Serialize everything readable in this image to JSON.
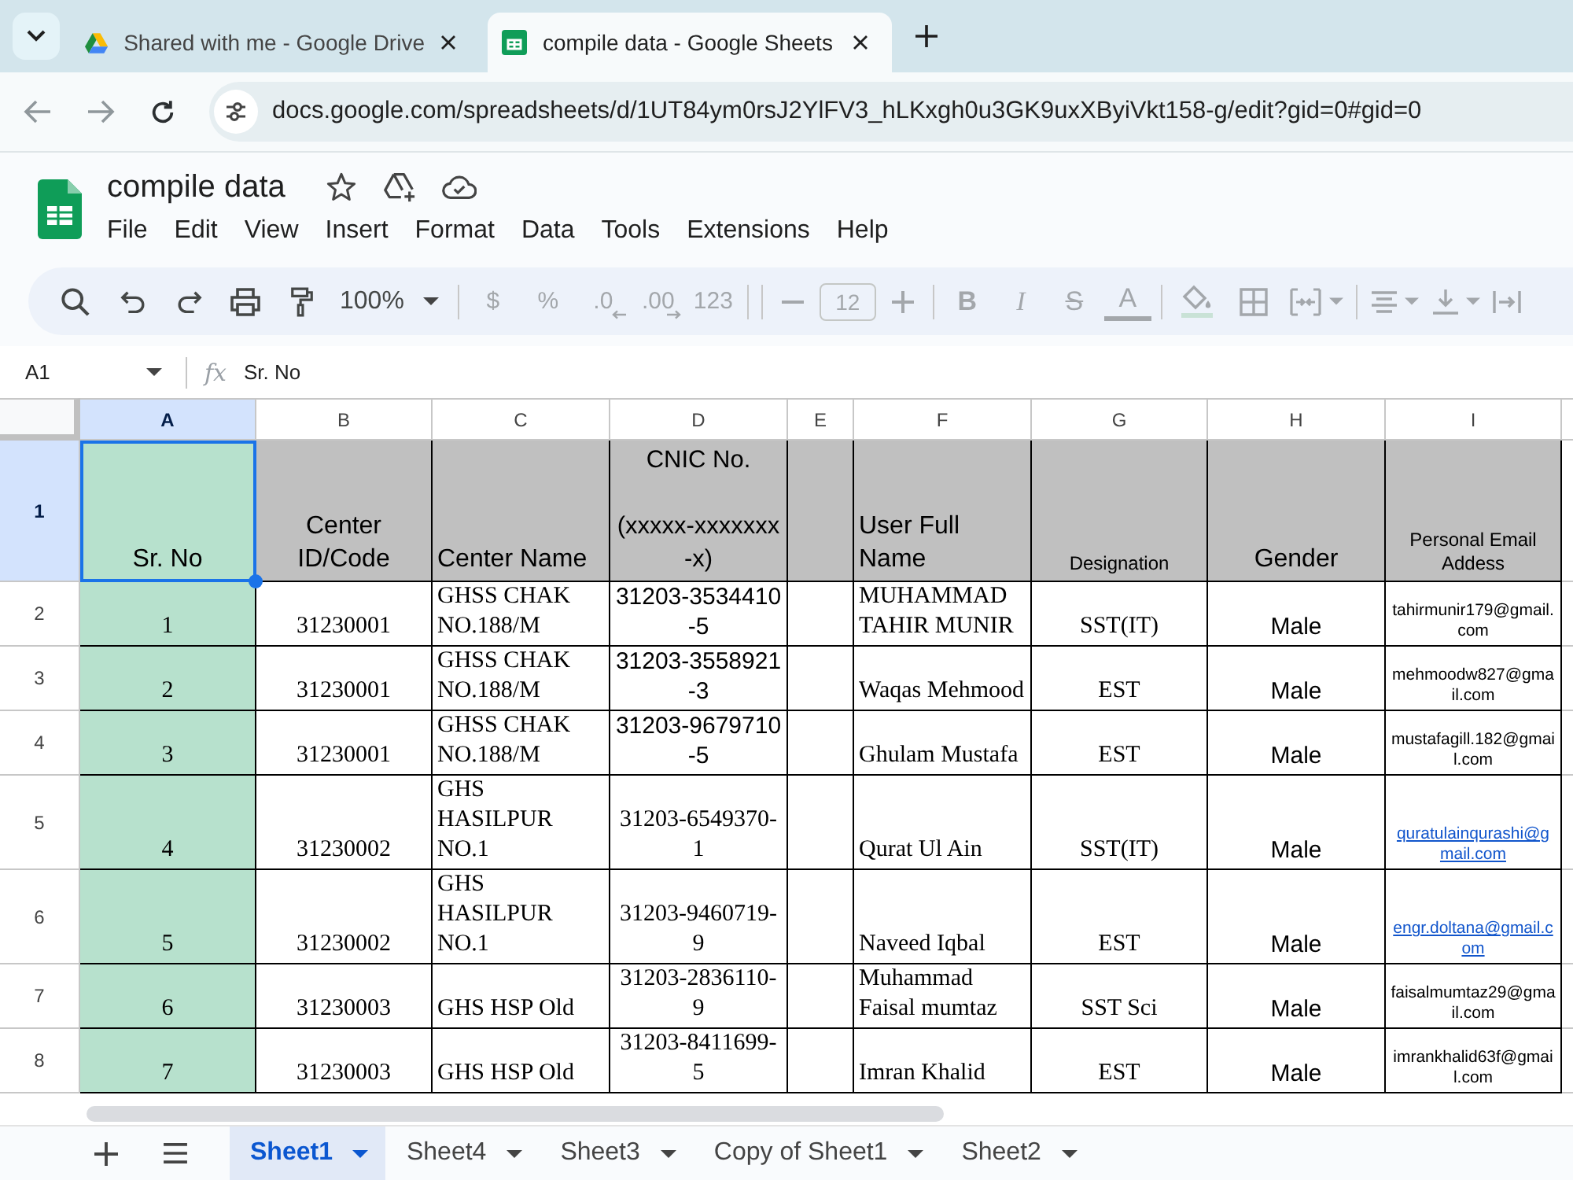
{
  "browser": {
    "tabs": [
      {
        "title": "Shared with me - Google Drive",
        "kind": "drive",
        "selected": false
      },
      {
        "title": "compile data - Google Sheets",
        "kind": "sheets",
        "selected": true
      }
    ],
    "back_disabled": true,
    "forward_disabled": true,
    "url": "docs.google.com/spreadsheets/d/1UT84ym0rsJ2YlFV3_hLKxgh0u3GK9uxXByiVkt158-g/edit?gid=0#gid=0"
  },
  "document": {
    "title": "compile data",
    "menu": [
      "File",
      "Edit",
      "View",
      "Insert",
      "Format",
      "Data",
      "Tools",
      "Extensions",
      "Help"
    ]
  },
  "toolbar": {
    "zoom": "100%",
    "formatting_disabled": true,
    "number_formats": [
      "$",
      "%",
      ".0",
      ".00",
      "123"
    ],
    "font_size": "12",
    "text_styles": [
      "B",
      "I",
      "S",
      "A"
    ]
  },
  "formula_bar": {
    "cell_ref": "A1",
    "function_symbol": "fx",
    "content": "Sr. No"
  },
  "sheet": {
    "columns": [
      {
        "letter": "A",
        "selected": true
      },
      {
        "letter": "B",
        "selected": false
      },
      {
        "letter": "C",
        "selected": false
      },
      {
        "letter": "D",
        "selected": false
      },
      {
        "letter": "E",
        "selected": false
      },
      {
        "letter": "F",
        "selected": false
      },
      {
        "letter": "G",
        "selected": false
      },
      {
        "letter": "H",
        "selected": false
      },
      {
        "letter": "I",
        "selected": false
      }
    ],
    "header_row": {
      "number": "1",
      "selected": true,
      "sr_no": "Sr. No",
      "center_id": "Center ID/Code",
      "center_name": "Center Name",
      "cnic": "CNIC No.\n\n(xxxxx-xxxxxxx-x)",
      "user_full_name": "User Full Name",
      "designation": "Designation",
      "gender": "Gender",
      "email": "Personal Email Addess"
    },
    "rows": [
      {
        "number": "2",
        "selected": false,
        "sr_no": "1",
        "center_id": "31230001",
        "center_name": "GHSS CHAK NO.188/M",
        "cnic": "31203-3534410-5",
        "user_full_name": "MUHAMMAD TAHIR MUNIR",
        "designation": "SST(IT)",
        "gender": "Male",
        "email": {
          "text": "tahirmunir179@gmail.com",
          "link": false
        }
      },
      {
        "number": "3",
        "selected": false,
        "sr_no": "2",
        "center_id": "31230001",
        "center_name": "GHSS CHAK NO.188/M",
        "cnic": "31203-3558921-3",
        "user_full_name": "Waqas Mehmood",
        "designation": "EST",
        "gender": "Male",
        "email": {
          "text": "mehmoodw827@gmail.com",
          "link": false
        }
      },
      {
        "number": "4",
        "selected": false,
        "sr_no": "3",
        "center_id": "31230001",
        "center_name": "GHSS CHAK NO.188/M",
        "cnic": "31203-9679710-5",
        "user_full_name": "Ghulam Mustafa",
        "designation": "EST",
        "gender": "Male",
        "email": {
          "text": "mustafagill.182@gmail.com",
          "link": false
        }
      },
      {
        "number": "5",
        "selected": false,
        "sr_no": "4",
        "center_id": "31230002",
        "center_name": "GHS HASILPUR NO.1",
        "cnic": "31203-6549370-1",
        "user_full_name": "Qurat Ul Ain",
        "designation": "SST(IT)",
        "gender": "Male",
        "email": {
          "text": "quratulainqurashi@gmail.com",
          "link": true
        }
      },
      {
        "number": "6",
        "selected": false,
        "sr_no": "5",
        "center_id": "31230002",
        "center_name": "GHS HASILPUR NO.1",
        "cnic": "31203-9460719-9",
        "user_full_name": "Naveed Iqbal",
        "designation": "EST",
        "gender": "Male",
        "email": {
          "text": "engr.doltana@gmail.com",
          "link": true
        }
      },
      {
        "number": "7",
        "selected": false,
        "sr_no": "6",
        "center_id": "31230003",
        "center_name": "GHS HSP Old",
        "cnic": "31203-2836110-9",
        "user_full_name": "Muhammad Faisal mumtaz",
        "designation": "SST Sci",
        "gender": "Male",
        "email": {
          "text": "faisalmumtaz29@gmail.com",
          "link": false
        }
      },
      {
        "number": "8",
        "selected": false,
        "sr_no": "7",
        "center_id": "31230003",
        "center_name": "GHS HSP Old",
        "cnic": "31203-8411699-5",
        "user_full_name": "Imran Khalid",
        "designation": "EST",
        "gender": "Male",
        "email": {
          "text": "imrankhalid63f@gmail.com",
          "link": false
        }
      }
    ]
  },
  "sheet_tabs": [
    {
      "label": "Sheet1",
      "selected": true
    },
    {
      "label": "Sheet4",
      "selected": false
    },
    {
      "label": "Sheet3",
      "selected": false
    },
    {
      "label": "Copy of Sheet1",
      "selected": false
    },
    {
      "label": "Sheet2",
      "selected": false
    }
  ]
}
